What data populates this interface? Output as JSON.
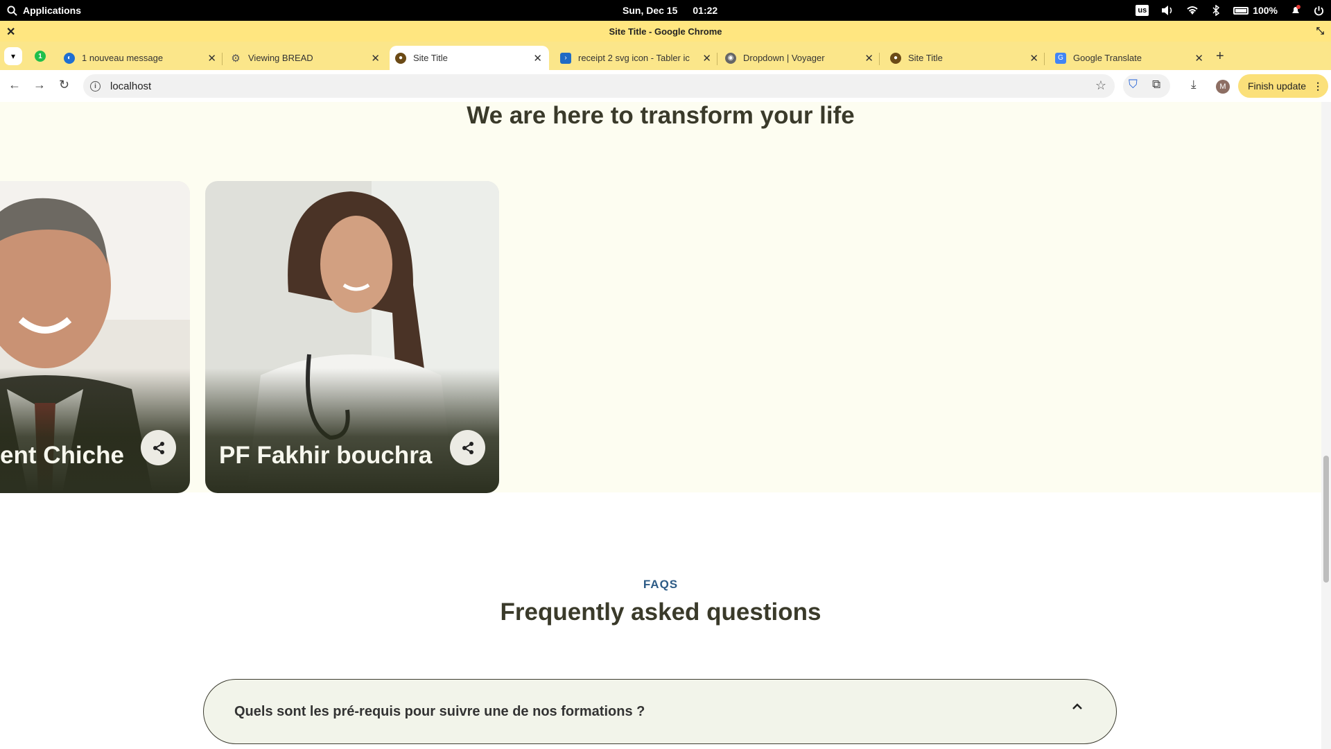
{
  "system_bar": {
    "apps_label": "Applications",
    "date": "Sun, Dec 15",
    "time": "01:22",
    "keyboard_layout": "us",
    "battery": "100%"
  },
  "window": {
    "title": "Site Title - Google Chrome"
  },
  "tabs": [
    {
      "label": "1 nouveau message",
      "favicon": "mail-icon",
      "color": "#1f6fd1"
    },
    {
      "label": "Viewing BREAD",
      "favicon": "gear-icon",
      "color": "#555555"
    },
    {
      "label": "Site Title",
      "favicon": "site-logo-icon",
      "color": "#6b4a16",
      "active": true
    },
    {
      "label": "receipt 2 svg icon - Tabler ic",
      "favicon": "tabler-icon",
      "color": "#206bc4"
    },
    {
      "label": "Dropdown | Voyager",
      "favicon": "voyager-icon",
      "color": "#666666"
    },
    {
      "label": "Site Title",
      "favicon": "site-logo-icon",
      "color": "#6b4a16"
    },
    {
      "label": "Google Translate",
      "favicon": "translate-icon",
      "color": "#4285f4"
    }
  ],
  "pinned_badge": "1",
  "toolbar": {
    "url": "localhost",
    "profile_initial": "M",
    "finish_update_label": "Finish update"
  },
  "hero": {
    "title": "We are here to transform your life"
  },
  "team": [
    {
      "name": "ent Chiche"
    },
    {
      "name": "PF Fakhir bouchra"
    }
  ],
  "faq": {
    "eyebrow": "FAQS",
    "title": "Frequently asked questions",
    "items": [
      {
        "question": "Quels sont les pré-requis pour suivre une de nos formations ?"
      }
    ]
  }
}
